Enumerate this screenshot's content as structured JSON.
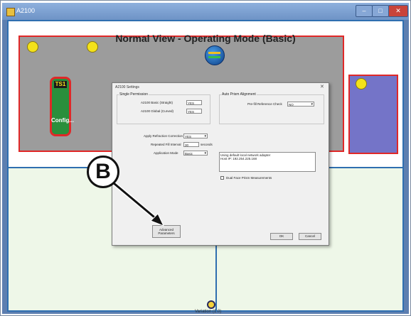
{
  "window": {
    "title": "A2100",
    "minimize": "–",
    "maximize": "□",
    "close": "✕"
  },
  "view": {
    "heading": "Normal View - Operating Mode (Basic)"
  },
  "tile": {
    "tag": "TS1",
    "label": "Config..."
  },
  "bottom": {
    "label": "Variation (1.0)"
  },
  "dialog": {
    "title": "A2100 Settings",
    "close": "✕",
    "single_permission": {
      "group_label": "Single Permission",
      "basic_label": "A2100 Basic (Straight)",
      "basic_value": "YES",
      "global_label": "A2100 Global (Curved)",
      "global_value": "YES"
    },
    "auto_prism": {
      "group_label": "Auto Prism Alignment",
      "ref_label": "Pre-fill Reference Check",
      "ref_value": "NO"
    },
    "refraction_label": "Apply Refraction Correction",
    "refraction_value": "YES",
    "interval_label": "Repeated Fill Interval",
    "interval_value": "30",
    "interval_unit": "seconds",
    "app_mode_label": "Application Mode",
    "app_mode_value": "Basic",
    "network_info": "Using default local network adapter\nHost IP: 192.254.225.168",
    "dual_face_label": "Dual Face Prism Measurements",
    "edit_button": "Advanced\nParameters",
    "ok_button": "OK",
    "cancel_button": "Cancel"
  },
  "callout": {
    "letter": "B"
  },
  "colors": {
    "zone_border": "#e02828",
    "zone_gray": "#9c9c9c",
    "zone_purple": "#7474c8",
    "marker": "#f4e21a",
    "divider": "#2f6fb0"
  }
}
